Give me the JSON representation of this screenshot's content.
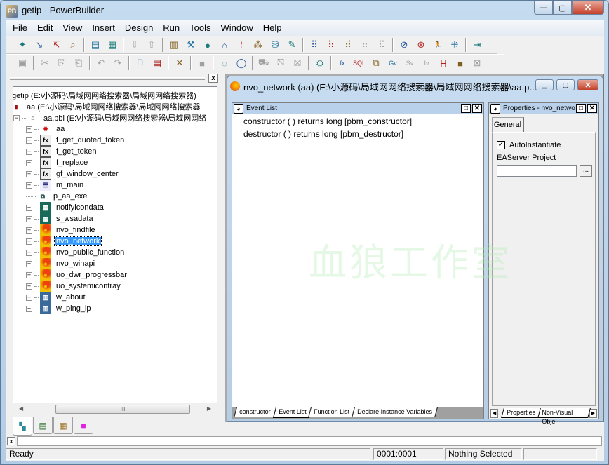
{
  "window": {
    "title": "getip - PowerBuilder",
    "app_icon": "pb-app-icon",
    "controls": {
      "minimize": "—",
      "maximize": "▢",
      "close": "✕"
    }
  },
  "menubar": {
    "items": [
      "File",
      "Edit",
      "View",
      "Insert",
      "Design",
      "Run",
      "Tools",
      "Window",
      "Help"
    ]
  },
  "toolbar1": {
    "buttons": [
      {
        "name": "new-icon",
        "glyph": "✦",
        "enabled": true
      },
      {
        "name": "inherit-icon",
        "glyph": "↘",
        "enabled": true
      },
      {
        "name": "open-icon",
        "glyph": "⇱",
        "enabled": true
      },
      {
        "name": "preview-icon",
        "glyph": "⌕",
        "enabled": true
      },
      {
        "name": "layout-icon",
        "glyph": "▤",
        "enabled": true
      },
      {
        "name": "properties-view-icon",
        "glyph": "▦",
        "enabled": true
      },
      {
        "name": "import-icon",
        "glyph": "⇩",
        "enabled": false
      },
      {
        "name": "export-icon",
        "glyph": "⇧",
        "enabled": false
      },
      {
        "name": "library-icon",
        "glyph": "▥",
        "enabled": true
      },
      {
        "name": "build-icon",
        "glyph": "⚒",
        "enabled": true
      },
      {
        "name": "debug-icon",
        "glyph": "●",
        "enabled": true
      },
      {
        "name": "database-painter-icon",
        "glyph": "⌂",
        "enabled": true
      },
      {
        "name": "dbprofile-icon",
        "glyph": "⁞",
        "enabled": true
      },
      {
        "name": "components-icon",
        "glyph": "⁂",
        "enabled": true
      },
      {
        "name": "database-icon",
        "glyph": "⛁",
        "enabled": true
      },
      {
        "name": "edit-source-icon",
        "glyph": "✎",
        "enabled": true
      },
      {
        "name": "deploy-icon",
        "glyph": "⠿",
        "enabled": true
      },
      {
        "name": "deploy-all-icon",
        "glyph": "⠷",
        "enabled": true
      },
      {
        "name": "incremental-icon",
        "glyph": "⠾",
        "enabled": true
      },
      {
        "name": "full-build-icon",
        "glyph": "⠶",
        "enabled": false
      },
      {
        "name": "rebuild-icon",
        "glyph": "⠯",
        "enabled": false
      },
      {
        "name": "stop-debug-icon",
        "glyph": "⊘",
        "enabled": true
      },
      {
        "name": "breakpoints-icon",
        "glyph": "⊛",
        "enabled": true
      },
      {
        "name": "run-icon",
        "glyph": "🏃",
        "enabled": true
      },
      {
        "name": "select-run-icon",
        "glyph": "⁜",
        "enabled": true
      },
      {
        "name": "exit-icon",
        "glyph": "⇥",
        "enabled": true
      }
    ]
  },
  "toolbar2": {
    "buttons": [
      {
        "name": "save-icon",
        "glyph": "▣",
        "enabled": false
      },
      {
        "name": "cut-icon",
        "glyph": "✂",
        "enabled": false
      },
      {
        "name": "copy-icon",
        "glyph": "⎘",
        "enabled": false
      },
      {
        "name": "paste-icon",
        "glyph": "⎗",
        "enabled": false
      },
      {
        "name": "undo-icon",
        "glyph": "↶",
        "enabled": false
      },
      {
        "name": "redo-icon",
        "glyph": "↷",
        "enabled": false
      },
      {
        "name": "new-document-icon",
        "glyph": "🗋",
        "enabled": true
      },
      {
        "name": "properties-icon",
        "glyph": "▤",
        "enabled": true
      },
      {
        "name": "delete-icon",
        "glyph": "✕",
        "enabled": true
      },
      {
        "name": "select-all-icon",
        "glyph": "■",
        "enabled": false
      },
      {
        "name": "comment-icon",
        "glyph": "◌",
        "enabled": true
      },
      {
        "name": "uncomment-icon",
        "glyph": "◯",
        "enabled": true
      },
      {
        "name": "find-icon",
        "glyph": "⛟",
        "enabled": false
      },
      {
        "name": "find-next-icon",
        "glyph": "⛞",
        "enabled": false
      },
      {
        "name": "replace-icon",
        "glyph": "⛝",
        "enabled": false
      },
      {
        "name": "compile-icon",
        "glyph": "⛭",
        "enabled": true
      },
      {
        "name": "paste-function-icon",
        "glyph": "fx",
        "enabled": true
      },
      {
        "name": "paste-sql-icon",
        "glyph": "SQL",
        "enabled": true
      },
      {
        "name": "paste-statement-icon",
        "glyph": "⧉",
        "enabled": true
      },
      {
        "name": "global-var-icon",
        "glyph": "Gv",
        "enabled": true
      },
      {
        "name": "shared-var-icon",
        "glyph": "Sv",
        "enabled": false
      },
      {
        "name": "instance-var-icon",
        "glyph": "Iv",
        "enabled": false
      },
      {
        "name": "object-icon",
        "glyph": "H",
        "enabled": true
      },
      {
        "name": "window-icon",
        "glyph": "■",
        "enabled": true
      },
      {
        "name": "close-var-icon",
        "glyph": "⊠",
        "enabled": false
      }
    ]
  },
  "system_tree": {
    "close": "x",
    "nodes": [
      {
        "label": "getip (E:\\小源码\\局域网网络搜索器\\局域网网络搜索器)",
        "icon": "workspace-icon",
        "expander": false
      },
      {
        "label": "aa (E:\\小源码\\局域网网络搜索器\\局域网网络搜索器",
        "icon": "target-icon",
        "expander": false
      },
      {
        "label": "aa.pbl (E:\\小源码\\局域网网络搜索器\\局域网网络",
        "icon": "library-icon",
        "expander": "−"
      },
      {
        "label": "aa",
        "icon": "application-icon",
        "expander": "+"
      },
      {
        "label": "f_get_quoted_token",
        "icon": "function-icon",
        "expander": "+"
      },
      {
        "label": "f_get_token",
        "icon": "function-icon",
        "expander": "+"
      },
      {
        "label": "f_replace",
        "icon": "function-icon",
        "expander": "+"
      },
      {
        "label": "gf_window_center",
        "icon": "function-icon",
        "expander": "+"
      },
      {
        "label": "m_main",
        "icon": "menu-icon",
        "expander": "+"
      },
      {
        "label": "p_aa_exe",
        "icon": "project-icon",
        "expander": false
      },
      {
        "label": "notifyicondata",
        "icon": "structure-icon",
        "expander": "+"
      },
      {
        "label": "s_wsadata",
        "icon": "structure-icon",
        "expander": "+"
      },
      {
        "label": "nvo_findfile",
        "icon": "user-object-icon",
        "expander": "+"
      },
      {
        "label": "nvo_network",
        "icon": "user-object-icon",
        "expander": "+",
        "selected": true
      },
      {
        "label": "nvo_public_function",
        "icon": "user-object-icon",
        "expander": "+"
      },
      {
        "label": "nvo_winapi",
        "icon": "user-object-icon",
        "expander": "+"
      },
      {
        "label": "uo_dwr_progressbar",
        "icon": "user-object-icon",
        "expander": "+"
      },
      {
        "label": "uo_systemicontray",
        "icon": "user-object-icon",
        "expander": "+"
      },
      {
        "label": "w_about",
        "icon": "window-icon",
        "expander": "+"
      },
      {
        "label": "w_ping_ip",
        "icon": "window-icon",
        "expander": "+"
      }
    ],
    "scroll_thumb": "III",
    "tabs": [
      "system-tree-tab",
      "output-tab",
      "clip-tab",
      "components-tab"
    ]
  },
  "painter": {
    "title": "nvo_network (aa) (E:\\小源码\\局域网网络搜索器\\局域网网络搜索器\\aa.p...",
    "event_list": {
      "title": "Event List",
      "events": [
        "constructor ( )  returns long [pbm_constructor]",
        "destructor ( )  returns long [pbm_destructor]"
      ],
      "tabs": [
        "constructor",
        "Event List",
        "Function List",
        "Declare Instance Variables"
      ],
      "active_tab": "Event List"
    },
    "properties": {
      "title": "Properties - nvo_netwo",
      "tab": "General",
      "auto_instantiate_label": "AutoInstantiate",
      "auto_instantiate_checked": true,
      "easerver_label": "EAServer Project",
      "easerver_value": "",
      "browse_label": "...",
      "tabs": [
        "Properties",
        "Non-Visual Obje"
      ]
    },
    "watermark": "血狼工作室"
  },
  "statusbar": {
    "status": "Ready",
    "position": "0001:0001",
    "selection": "Nothing Selected"
  }
}
